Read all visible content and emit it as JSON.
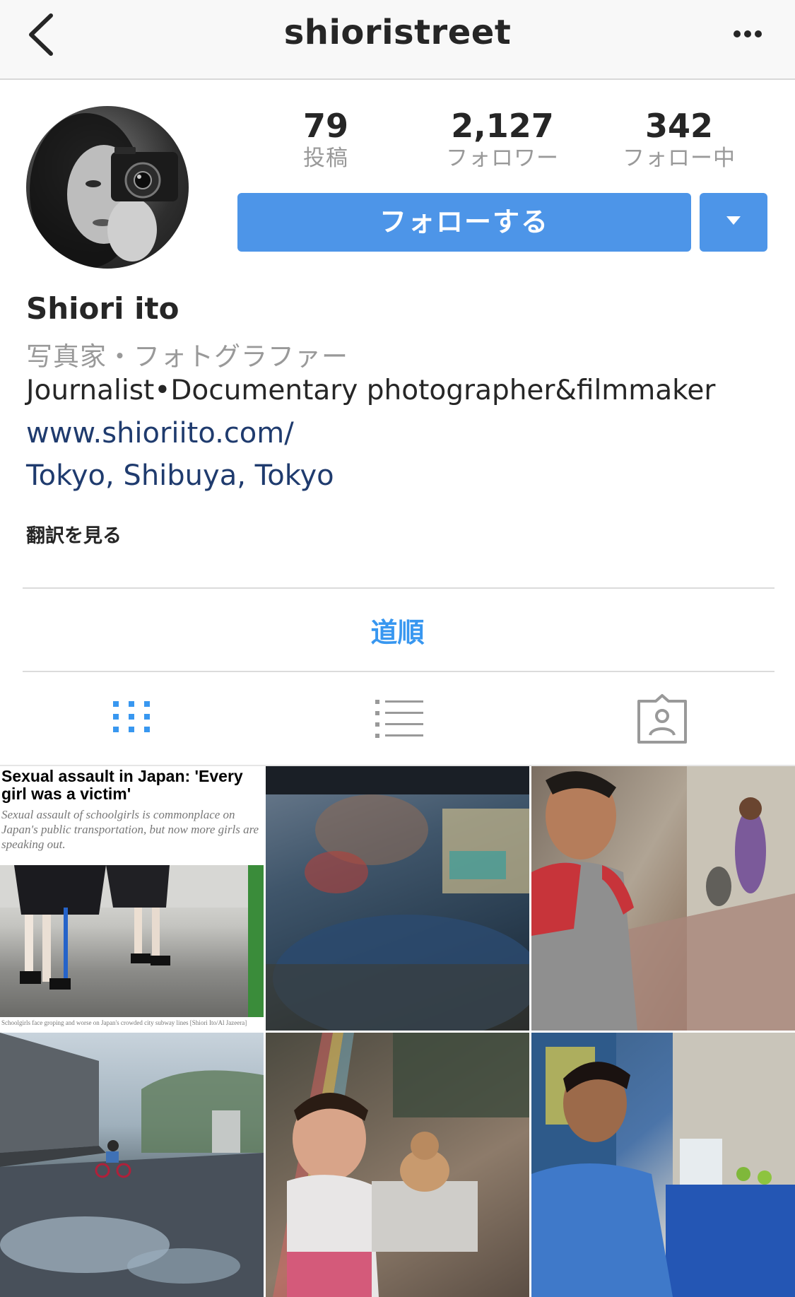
{
  "nav": {
    "title": "shioristreet",
    "back_icon": "chevron-left-icon",
    "more_icon": "more-horizontal-icon"
  },
  "profile": {
    "stats": [
      {
        "value": "79",
        "label": "投稿"
      },
      {
        "value": "2,127",
        "label": "フォロワー"
      },
      {
        "value": "342",
        "label": "フォロー中"
      }
    ],
    "follow_label": "フォローする",
    "dropdown_icon": "caret-down-icon",
    "accent_color": "#4d95e8"
  },
  "bio": {
    "name": "Shiori ito",
    "category": "写真家・フォトグラファー",
    "text": "Journalist•Documentary photographer&filmmaker",
    "link": "www.shioriito.com/",
    "location": "Tokyo, Shibuya, Tokyo",
    "translate": "翻訳を見る"
  },
  "directions": {
    "label": "道順",
    "color": "#3897f0"
  },
  "tabs": [
    {
      "icon": "grid-icon",
      "active": true
    },
    {
      "icon": "list-icon",
      "active": false
    },
    {
      "icon": "tagged-person-icon",
      "active": false
    }
  ],
  "posts": {
    "article": {
      "headline": "Sexual assault in Japan: 'Every girl was a victim'",
      "subhead": "Sexual assault of schoolgirls is commonplace on Japan's public transportation, but now more girls are speaking out.",
      "caption": "Schoolgirls face groping and worse on Japan's crowded city subway lines [Shiori Ito/Al Jazeera]"
    }
  }
}
